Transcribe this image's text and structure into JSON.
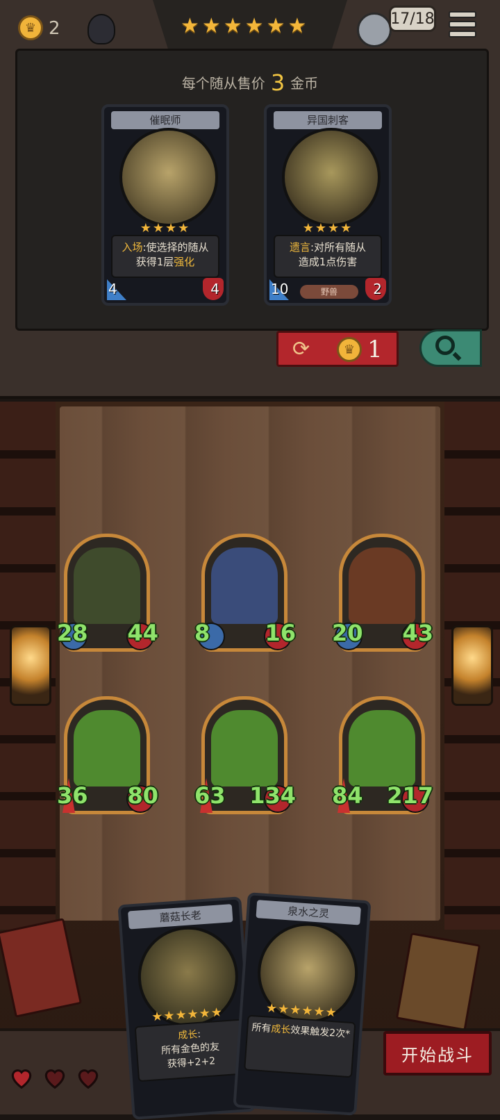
{
  "topbar": {
    "gold": "2",
    "stars": "★★★★★★",
    "turn_counter": "17/18"
  },
  "shop": {
    "price_prefix": "每个随从售价",
    "price_value": "3",
    "price_suffix": "金币",
    "cards": [
      {
        "name": "催眠师",
        "stars": "★★★★",
        "desc_keyword": "入场",
        "desc_text1": ":使选择的随从",
        "desc_text2a": "获得1层",
        "desc_keyword2": "强化",
        "attack": "4",
        "health": "4",
        "tribe": ""
      },
      {
        "name": "异国刺客",
        "stars": "★★★★",
        "desc_keyword": "遗言",
        "desc_text1": ":对所有随从",
        "desc_text2a": "造成1点伤害",
        "desc_keyword2": "",
        "attack": "10",
        "health": "2",
        "tribe": "野兽"
      }
    ],
    "refresh_cost": "1"
  },
  "board": {
    "units": [
      {
        "attack": "28",
        "health": "44",
        "color": "#3f4b2c"
      },
      {
        "attack": "8",
        "health": "16",
        "color": "#3a4c7a"
      },
      {
        "attack": "20",
        "health": "43",
        "color": "#6a3a24"
      },
      {
        "attack": "36",
        "health": "80",
        "color": "#4f8a2f"
      },
      {
        "attack": "63",
        "health": "134",
        "color": "#4f8a2f"
      },
      {
        "attack": "84",
        "health": "217",
        "color": "#4f8a2f"
      }
    ]
  },
  "hand": {
    "cards": [
      {
        "name": "蘑菇长老",
        "stars": "★★★★★★",
        "keyword": "成长",
        "line1": ":",
        "line2": "所有金色的友",
        "line3": "获得+2+2"
      },
      {
        "name": "泉水之灵",
        "stars": "★★★★★★",
        "prefix": "所有",
        "keyword": "成长",
        "suffix": "效果触发2次*"
      }
    ]
  },
  "bottom": {
    "lives": 3,
    "start_label": "开始战斗"
  },
  "colors": {
    "gold": "#f3b63a",
    "red_button": "#b3262c",
    "green_stat": "#8fe36b"
  }
}
